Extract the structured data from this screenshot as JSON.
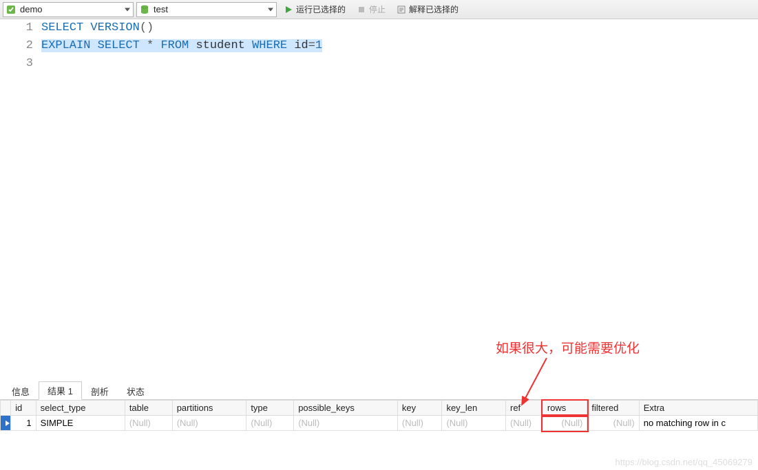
{
  "toolbar": {
    "connection": "demo",
    "database": "test",
    "run_label": "运行已选择的",
    "stop_label": "停止",
    "explain_label": "解释已选择的"
  },
  "editor": {
    "lines": [
      {
        "n": "1",
        "tokens": [
          {
            "t": "SELECT",
            "c": "kw"
          },
          {
            "t": " ",
            "c": ""
          },
          {
            "t": "VERSION",
            "c": "kw"
          },
          {
            "t": "()",
            "c": "op"
          }
        ],
        "selected": false
      },
      {
        "n": "2",
        "tokens": [],
        "selected": false
      },
      {
        "n": "3",
        "tokens": [
          {
            "t": "EXPLAIN",
            "c": "kw"
          },
          {
            "t": " ",
            "c": ""
          },
          {
            "t": "SELECT",
            "c": "kw"
          },
          {
            "t": " ",
            "c": ""
          },
          {
            "t": "*",
            "c": "op"
          },
          {
            "t": " ",
            "c": ""
          },
          {
            "t": "FROM",
            "c": "kw"
          },
          {
            "t": " ",
            "c": ""
          },
          {
            "t": "student",
            "c": "txtc"
          },
          {
            "t": " ",
            "c": ""
          },
          {
            "t": "WHERE",
            "c": "kw"
          },
          {
            "t": " ",
            "c": ""
          },
          {
            "t": "id",
            "c": "txtc"
          },
          {
            "t": "=",
            "c": "op"
          },
          {
            "t": "1",
            "c": "num"
          }
        ],
        "selected": true
      }
    ]
  },
  "tabs": {
    "items": [
      "信息",
      "结果 1",
      "剖析",
      "状态"
    ],
    "active": 1
  },
  "grid": {
    "columns": [
      "id",
      "select_type",
      "table",
      "partitions",
      "type",
      "possible_keys",
      "key",
      "key_len",
      "ref",
      "rows",
      "filtered",
      "Extra"
    ],
    "row": {
      "id": "1",
      "select_type": "SIMPLE",
      "table": "(Null)",
      "partitions": "(Null)",
      "type": "(Null)",
      "possible_keys": "(Null)",
      "key": "(Null)",
      "key_len": "(Null)",
      "ref": "(Null)",
      "rows": "(Null)",
      "filtered": "(Null)",
      "Extra": "no matching row in c"
    }
  },
  "annotation": "如果很大，可能需要优化",
  "watermark": "https://blog.csdn.net/qq_45069279"
}
